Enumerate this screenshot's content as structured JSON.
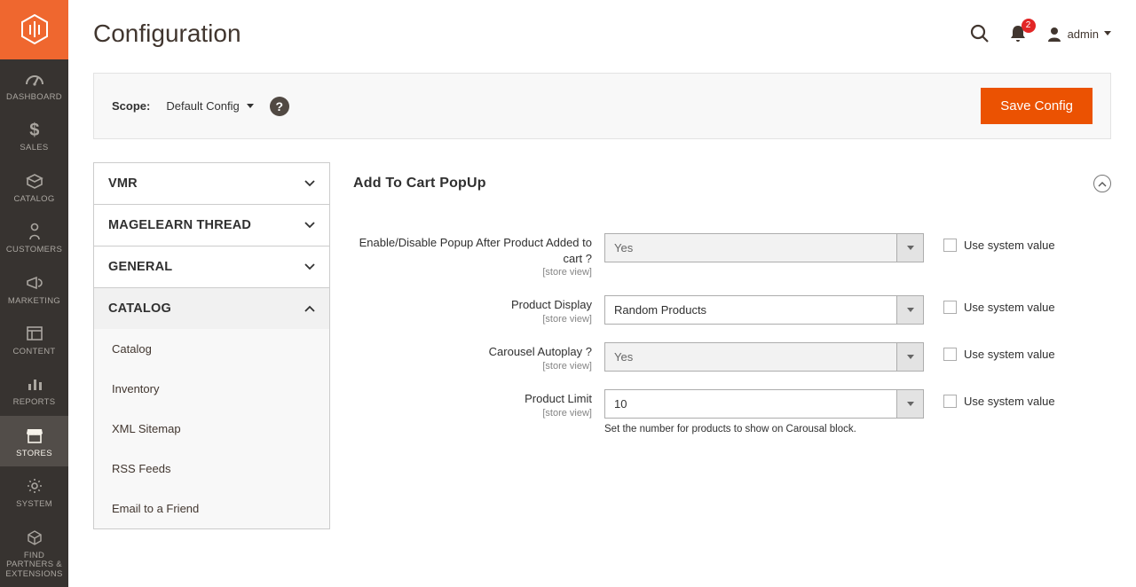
{
  "page_title": "Configuration",
  "user_name": "admin",
  "notification_count": "2",
  "scope": {
    "label": "Scope:",
    "value": "Default Config"
  },
  "save_button": "Save Config",
  "sidebar": [
    {
      "label": "DASHBOARD",
      "icon": "dashboard"
    },
    {
      "label": "SALES",
      "icon": "dollar"
    },
    {
      "label": "CATALOG",
      "icon": "box"
    },
    {
      "label": "CUSTOMERS",
      "icon": "person"
    },
    {
      "label": "MARKETING",
      "icon": "megaphone"
    },
    {
      "label": "CONTENT",
      "icon": "layout"
    },
    {
      "label": "REPORTS",
      "icon": "bars"
    },
    {
      "label": "STORES",
      "icon": "store",
      "active": true
    },
    {
      "label": "SYSTEM",
      "icon": "gear"
    },
    {
      "label": "FIND PARTNERS & EXTENSIONS",
      "icon": "cube"
    }
  ],
  "config_nav": [
    {
      "label": "VMR",
      "expanded": false
    },
    {
      "label": "MAGELEARN THREAD",
      "expanded": false
    },
    {
      "label": "GENERAL",
      "expanded": false
    },
    {
      "label": "CATALOG",
      "expanded": true,
      "items": [
        "Catalog",
        "Inventory",
        "XML Sitemap",
        "RSS Feeds",
        "Email to a Friend"
      ]
    }
  ],
  "section_title": "Add To Cart PopUp",
  "store_view_hint": "[store view]",
  "use_system_value": "Use system value",
  "fields": {
    "enable": {
      "label": "Enable/Disable Popup After Product Added to cart ?",
      "value": "Yes"
    },
    "product_display": {
      "label": "Product Display",
      "value": "Random Products"
    },
    "carousel_autoplay": {
      "label": "Carousel Autoplay ?",
      "value": "Yes"
    },
    "product_limit": {
      "label": "Product Limit",
      "value": "10",
      "note": "Set the number for products to show on Carousal block."
    }
  }
}
